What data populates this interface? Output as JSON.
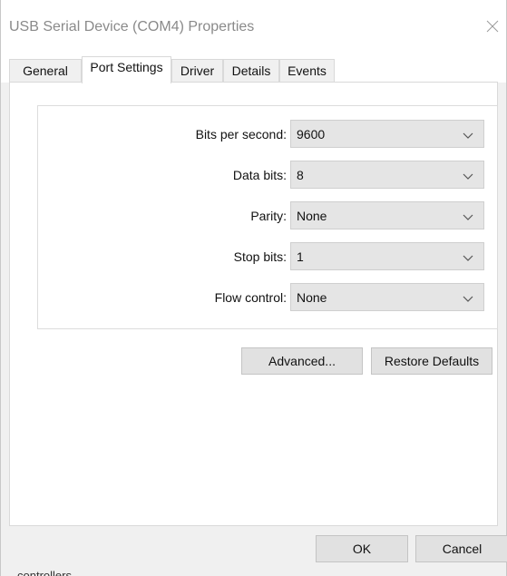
{
  "window": {
    "title": "USB Serial Device (COM4) Properties"
  },
  "tabs": [
    {
      "label": "General",
      "active": false
    },
    {
      "label": "Port Settings",
      "active": true
    },
    {
      "label": "Driver",
      "active": false
    },
    {
      "label": "Details",
      "active": false
    },
    {
      "label": "Events",
      "active": false
    }
  ],
  "port_settings": {
    "bits_per_second": {
      "label": "Bits per second:",
      "value": "9600"
    },
    "data_bits": {
      "label": "Data bits:",
      "value": "8"
    },
    "parity": {
      "label": "Parity:",
      "value": "None"
    },
    "stop_bits": {
      "label": "Stop bits:",
      "value": "1"
    },
    "flow_control": {
      "label": "Flow control:",
      "value": "None"
    }
  },
  "buttons": {
    "advanced": "Advanced...",
    "restore_defaults": "Restore Defaults",
    "ok": "OK",
    "cancel": "Cancel"
  },
  "background_text": "controllers",
  "icons": {
    "close": "close-icon",
    "dropdown": "chevron-down-icon"
  },
  "colors": {
    "title_text": "#8a8a8a",
    "combo_bg": "#e5e5e5",
    "button_bg": "#e1e1e1",
    "dialog_bg": "#f0f0f0"
  }
}
